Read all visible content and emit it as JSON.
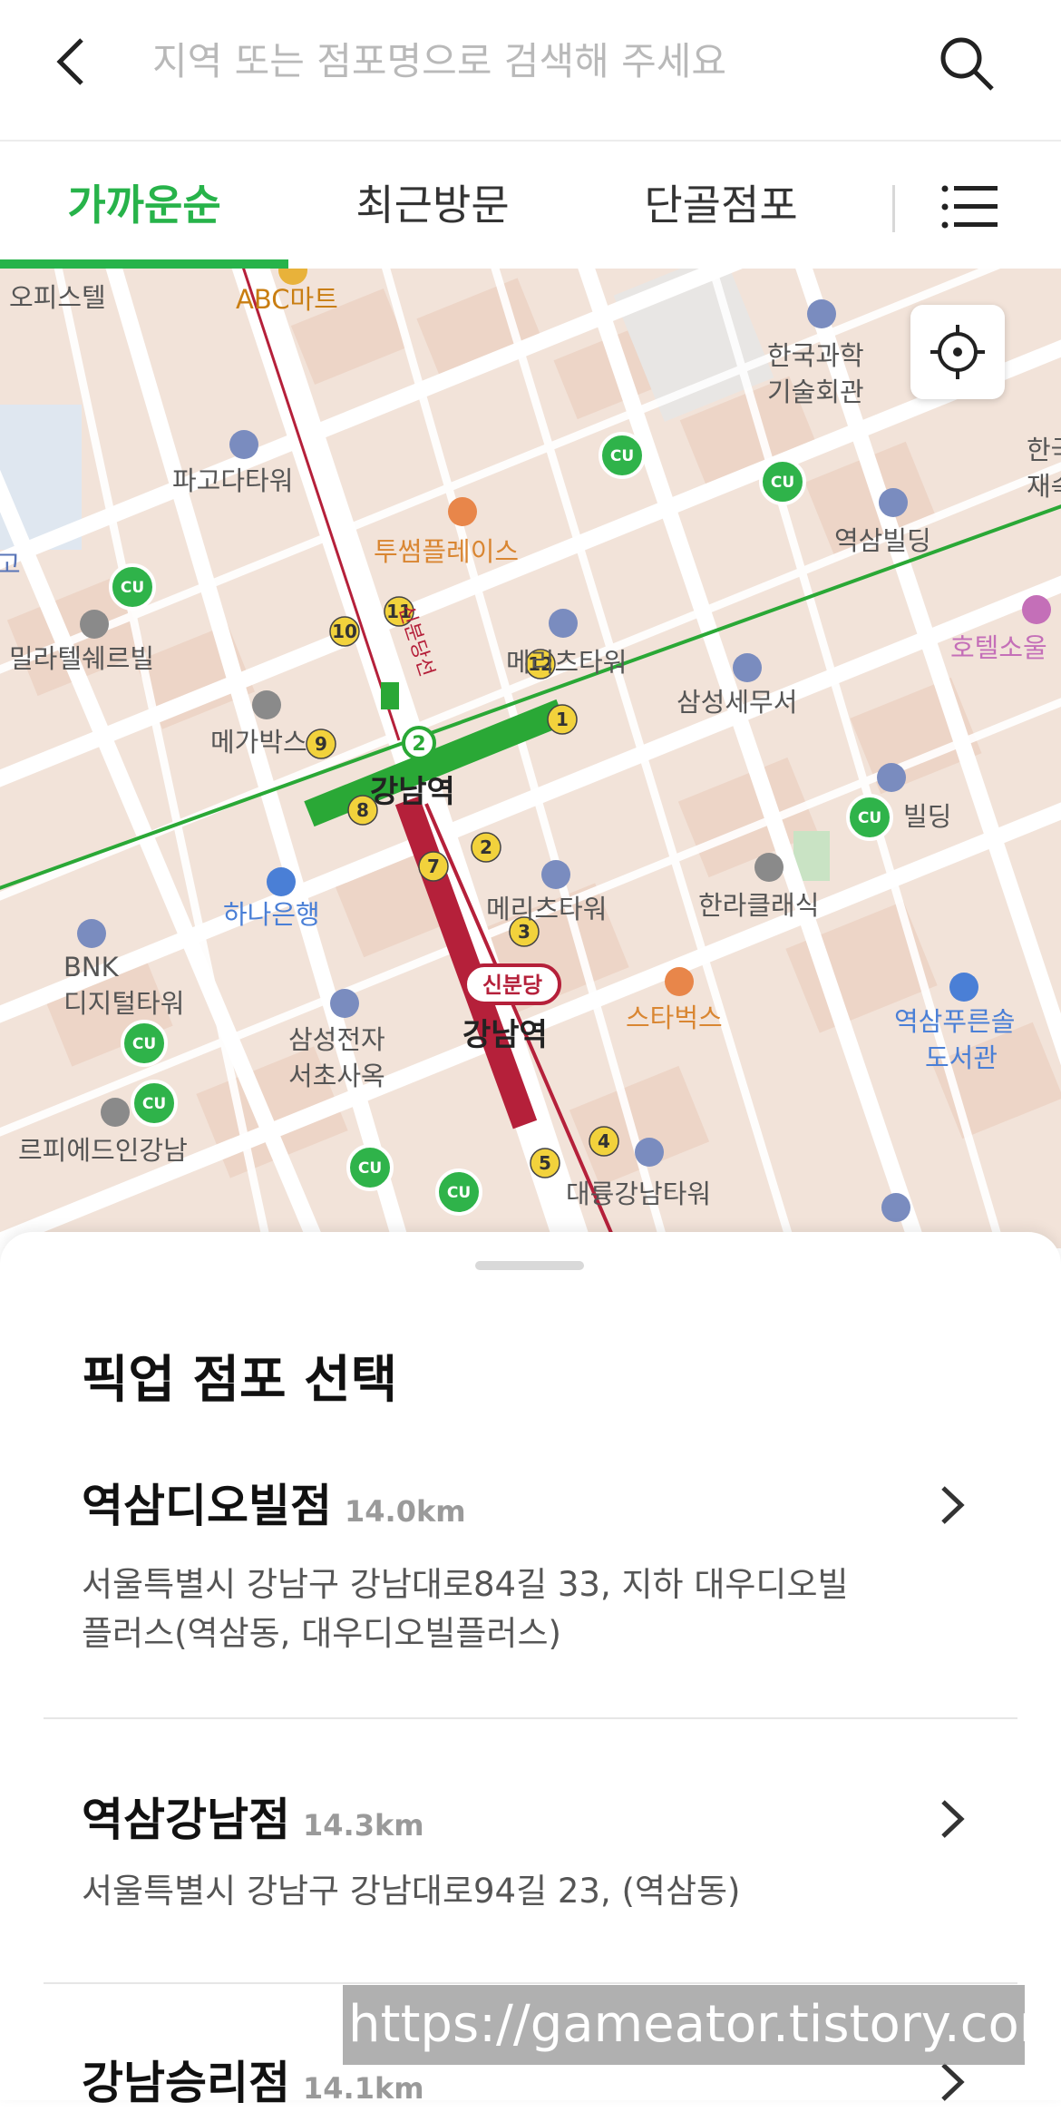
{
  "header": {
    "search_placeholder": "지역 또는 점포명으로 검색해 주세요"
  },
  "tabs": [
    {
      "label": "가까운순",
      "active": true
    },
    {
      "label": "최근방문",
      "active": false
    },
    {
      "label": "단골점포",
      "active": false
    }
  ],
  "map": {
    "labels": {
      "abc": "ABC마트",
      "officetel": "오피스텔",
      "hangkwa1": "한국과학",
      "hangkwa2": "기술회관",
      "pagoda": "파고다타워",
      "twosome": "투썸플레이스",
      "yeoksam_bldg": "역삼빌딩",
      "hotel": "호텔소울",
      "milatel": "밀라텔쉐르빌",
      "megabox": "메가박스",
      "meritz12": "메리츠타워",
      "tax": "삼성세무서",
      "gangnam_station": "강남역",
      "bldg_right": "빌딩",
      "hana": "하나은행",
      "meritz": "메리츠타워",
      "hanra": "한라클래식",
      "bnk1": "BNK",
      "bnk2": "디지털타워",
      "sinbundang": "신분당",
      "gangnam2": "강남역",
      "starbucks": "스타벅스",
      "library1": "역삼푸른솔",
      "library2": "도서관",
      "samsung1": "삼성전자",
      "samsung2": "서초사옥",
      "repide": "르피에드인강남",
      "daeryung": "대륭강남타워",
      "line": "신분당선",
      "edge_left": "고",
      "edge_right1": "한국",
      "edge_right2": "재속",
      "cu": "CU"
    }
  },
  "sheet": {
    "title": "픽업 점포 선택",
    "stores": [
      {
        "name": "역삼디오빌점",
        "distance": "14.0km",
        "address": "서울특별시 강남구 강남대로84길 33, 지하 대우디오빌플러스(역삼동, 대우디오빌플러스)"
      },
      {
        "name": "역삼강남점",
        "distance": "14.3km",
        "address": "서울특별시 강남구 강남대로94길 23, (역삼동)"
      },
      {
        "name": "강남승리점",
        "distance": "14.1km",
        "address": ""
      }
    ]
  },
  "watermark": "https://gameator.tistory.com",
  "colors": {
    "accent": "#27b34a",
    "line2": "#2aa836",
    "sinbundang": "#b5203a",
    "exit": "#f2d23c"
  }
}
